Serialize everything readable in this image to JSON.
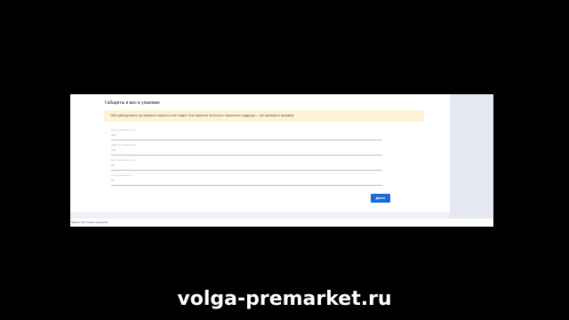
{
  "card": {
    "title": "Габариты и вес в упаковке",
    "notice": "ОВА заблокированы, мы замерили габариты и вес товара. Если заметили неточность, напишите в поддержку — всё проверим и исправим.",
    "fields": [
      {
        "label": "Длина упаковки, см *",
        "value": "200"
      },
      {
        "label": "Ширина упаковки, см *",
        "value": "100"
      },
      {
        "label": "Высота упаковки, см *",
        "value": "90"
      },
      {
        "label": "Вес в упаковке, кг *",
        "value": "80"
      }
    ],
    "next_label": "Далее"
  },
  "footer": {
    "text": "Маркет. Все права защищены"
  },
  "watermark": "volga-premarket.ru"
}
